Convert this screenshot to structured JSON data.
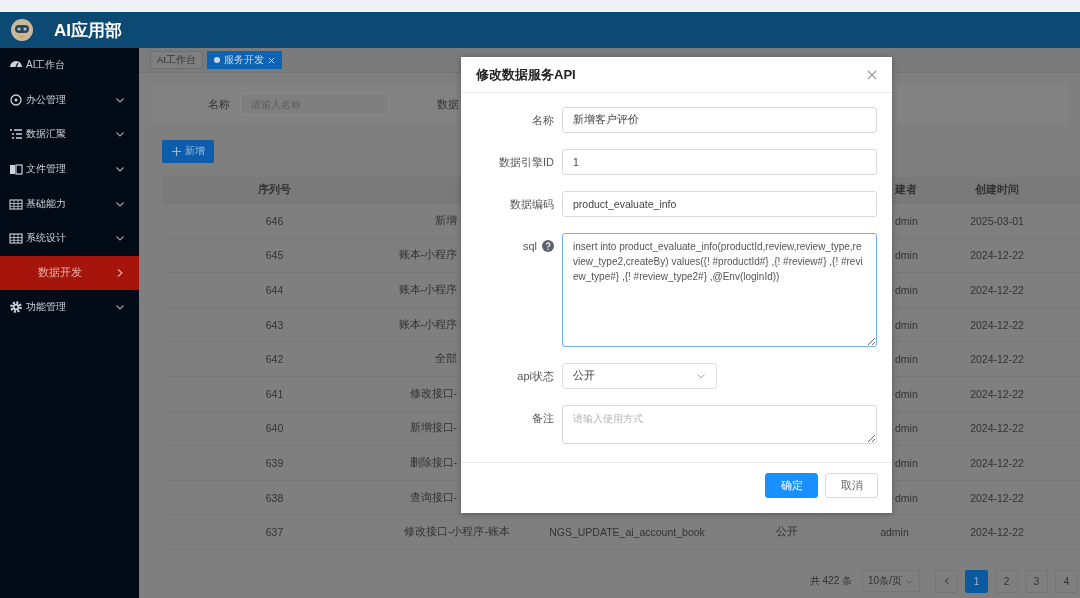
{
  "header": {
    "title": "AI应用部"
  },
  "sidebar": {
    "items": [
      {
        "label": "AI工作台",
        "submenu": false,
        "selected": false
      },
      {
        "label": "办公管理",
        "submenu": true,
        "selected": false
      },
      {
        "label": "数据汇聚",
        "submenu": true,
        "selected": false
      },
      {
        "label": "文件管理",
        "submenu": true,
        "selected": false
      },
      {
        "label": "基础能力",
        "submenu": true,
        "selected": false
      },
      {
        "label": "系统设计",
        "submenu": true,
        "selected": false
      },
      {
        "label": "数据开发",
        "submenu": true,
        "selected": true
      },
      {
        "label": "功能管理",
        "submenu": true,
        "selected": false
      }
    ]
  },
  "tabs": [
    {
      "label": "AI工作台",
      "selected": false,
      "closable": false
    },
    {
      "label": "服务开发",
      "selected": true,
      "closable": true
    }
  ],
  "search": {
    "fields": [
      {
        "label": "名称",
        "placeholder": "请输入名称"
      },
      {
        "label": "数据"
      }
    ]
  },
  "add_button": {
    "label": "新增"
  },
  "table": {
    "headers": [
      "序列号",
      "建者",
      "创建时间"
    ],
    "rows": [
      {
        "seq": "646",
        "name": "新增",
        "creator": "dmin",
        "created": "2025-03-01",
        "covered": true
      },
      {
        "seq": "645",
        "name": "账本-小程序",
        "creator": "dmin",
        "created": "2024-12-22",
        "covered": true
      },
      {
        "seq": "644",
        "name": "账本-小程序",
        "creator": "dmin",
        "created": "2024-12-22",
        "covered": true
      },
      {
        "seq": "643",
        "name": "账本-小程序",
        "creator": "dmin",
        "created": "2024-12-22",
        "covered": true
      },
      {
        "seq": "642",
        "name": "全部",
        "creator": "dmin",
        "created": "2024-12-22",
        "covered": true
      },
      {
        "seq": "641",
        "name": "修改接口-",
        "creator": "dmin",
        "created": "2024-12-22",
        "covered": true
      },
      {
        "seq": "640",
        "name": "新增接口-",
        "creator": "dmin",
        "created": "2024-12-22",
        "covered": true
      },
      {
        "seq": "639",
        "name": "删除接口-",
        "creator": "dmin",
        "created": "2024-12-22",
        "covered": true
      },
      {
        "seq": "638",
        "name": "查询接口-",
        "creator": "dmin",
        "created": "2024-12-22",
        "covered": true
      },
      {
        "seq": "637",
        "name": "修改接口-小程序-账本",
        "code": "NGS_UPDATE_ai_account_book",
        "status": "公开",
        "creator": "admin",
        "created": "2024-12-22"
      }
    ]
  },
  "pagination": {
    "total": "共 422 条",
    "page_size": "10条/页",
    "pages": [
      {
        "label": "1",
        "selected": true
      },
      {
        "label": "2",
        "selected": false
      },
      {
        "label": "3",
        "selected": false
      },
      {
        "label": "4",
        "selected": false
      }
    ]
  },
  "dialog": {
    "title": "修改数据服务API",
    "fields": [
      {
        "kind": "input",
        "label": "名称",
        "value": "新增客户评价"
      },
      {
        "kind": "input",
        "label": "数据引擎ID",
        "value": "1"
      },
      {
        "kind": "input",
        "label": "数据编码",
        "value": "product_evaluate_info"
      },
      {
        "kind": "textarea",
        "label": "sql",
        "help": true,
        "focused": true,
        "value": "insert into product_evaluate_info(productId,review,review_type,review_type2,createBy) values({! #productId#} ,{! #review#} ,{! #review_type#} ,{! #review_type2#} ,@Env(loginId))"
      },
      {
        "kind": "select",
        "label": "api状态",
        "value": "公开"
      },
      {
        "kind": "textarea",
        "label": "备注",
        "placeholder": "请输入使用方式"
      }
    ],
    "buttons": [
      {
        "label": "确定",
        "primary": true
      },
      {
        "label": "取消",
        "primary": false
      }
    ]
  }
}
